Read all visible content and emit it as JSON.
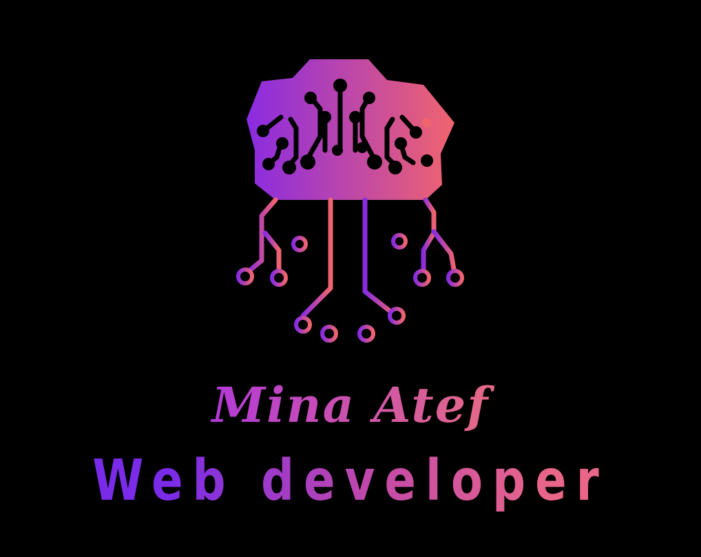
{
  "logo": {
    "icon": "circuit-brain-icon",
    "gradient_start": "#8a2be2",
    "gradient_end": "#f0646e"
  },
  "name": "Mina Atef",
  "role": "Web developer",
  "colors": {
    "background": "#000000",
    "accent_purple": "#8a2be2",
    "accent_coral": "#f0646e"
  }
}
